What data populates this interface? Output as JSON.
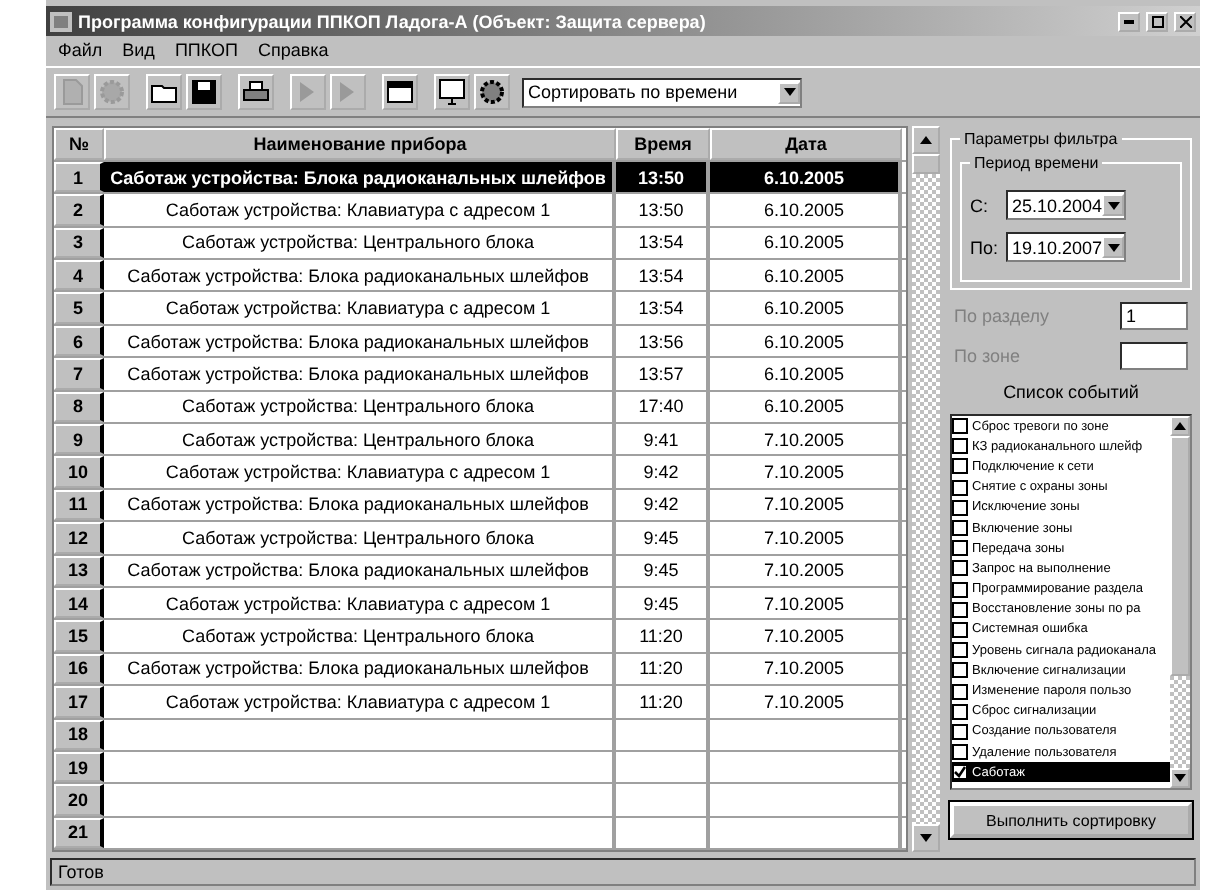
{
  "window": {
    "title": "Программа конфигурации ППКОП Ладога-А (Объект: Защита сервера)"
  },
  "menu": [
    "Файл",
    "Вид",
    "ППКОП",
    "Справка"
  ],
  "toolbar": {
    "buttons": [
      {
        "kind": "doc",
        "disabled": true
      },
      {
        "kind": "gear",
        "disabled": true
      },
      {
        "kind": "folder",
        "disabled": false
      },
      {
        "kind": "save",
        "disabled": false
      },
      {
        "kind": "printer",
        "disabled": false
      },
      {
        "kind": "arrow",
        "disabled": true
      },
      {
        "kind": "arrow",
        "disabled": true
      },
      {
        "kind": "window",
        "disabled": false
      },
      {
        "kind": "monitor",
        "disabled": false
      },
      {
        "kind": "gear",
        "disabled": false
      }
    ],
    "sort_select": {
      "value": "Сортировать по времени"
    }
  },
  "table": {
    "columns": [
      "№",
      "Наименование прибора",
      "Время",
      "Дата"
    ],
    "rows": [
      {
        "num": "1",
        "name": "Саботаж устройства: Блока радиоканальных шлейфов",
        "time": "13:50",
        "date": "6.10.2005",
        "selected": true
      },
      {
        "num": "2",
        "name": "Саботаж устройства: Клавиатура с адресом 1",
        "time": "13:50",
        "date": "6.10.2005",
        "selected": false
      },
      {
        "num": "3",
        "name": "Саботаж устройства: Центрального блока",
        "time": "13:54",
        "date": "6.10.2005",
        "selected": false
      },
      {
        "num": "4",
        "name": "Саботаж устройства: Блока радиоканальных шлейфов",
        "time": "13:54",
        "date": "6.10.2005",
        "selected": false
      },
      {
        "num": "5",
        "name": "Саботаж устройства: Клавиатура с адресом 1",
        "time": "13:54",
        "date": "6.10.2005",
        "selected": false
      },
      {
        "num": "6",
        "name": "Саботаж устройства: Блока радиоканальных шлейфов",
        "time": "13:56",
        "date": "6.10.2005",
        "selected": false
      },
      {
        "num": "7",
        "name": "Саботаж устройства: Блока радиоканальных шлейфов",
        "time": "13:57",
        "date": "6.10.2005",
        "selected": false
      },
      {
        "num": "8",
        "name": "Саботаж устройства: Центрального блока",
        "time": "17:40",
        "date": "6.10.2005",
        "selected": false
      },
      {
        "num": "9",
        "name": "Саботаж устройства: Центрального блока",
        "time": "9:41",
        "date": "7.10.2005",
        "selected": false
      },
      {
        "num": "10",
        "name": "Саботаж устройства: Клавиатура с адресом 1",
        "time": "9:42",
        "date": "7.10.2005",
        "selected": false
      },
      {
        "num": "11",
        "name": "Саботаж устройства: Блока радиоканальных шлейфов",
        "time": "9:42",
        "date": "7.10.2005",
        "selected": false
      },
      {
        "num": "12",
        "name": "Саботаж устройства: Центрального блока",
        "time": "9:45",
        "date": "7.10.2005",
        "selected": false
      },
      {
        "num": "13",
        "name": "Саботаж устройства: Блока радиоканальных шлейфов",
        "time": "9:45",
        "date": "7.10.2005",
        "selected": false
      },
      {
        "num": "14",
        "name": "Саботаж устройства: Клавиатура с адресом 1",
        "time": "9:45",
        "date": "7.10.2005",
        "selected": false
      },
      {
        "num": "15",
        "name": "Саботаж устройства: Центрального блока",
        "time": "11:20",
        "date": "7.10.2005",
        "selected": false
      },
      {
        "num": "16",
        "name": "Саботаж устройства: Блока радиоканальных шлейфов",
        "time": "11:20",
        "date": "7.10.2005",
        "selected": false
      },
      {
        "num": "17",
        "name": "Саботаж устройства: Клавиатура с адресом 1",
        "time": "11:20",
        "date": "7.10.2005",
        "selected": false
      },
      {
        "num": "18",
        "name": "",
        "time": "",
        "date": "",
        "selected": false
      },
      {
        "num": "19",
        "name": "",
        "time": "",
        "date": "",
        "selected": false
      },
      {
        "num": "20",
        "name": "",
        "time": "",
        "date": "",
        "selected": false
      },
      {
        "num": "21",
        "name": "",
        "time": "",
        "date": "",
        "selected": false
      }
    ]
  },
  "filter": {
    "title": "Параметры фильтра",
    "period": {
      "title": "Период времени",
      "from_label": "С:",
      "from": "25.10.2004",
      "to_label": "По:",
      "to": "19.10.2007"
    },
    "section_label": "По разделу",
    "section_value": "1",
    "zone_label": "По зоне",
    "events_title": "Список событий",
    "events": [
      {
        "label": "Сброс тревоги по зоне",
        "checked": false,
        "selected": false
      },
      {
        "label": "КЗ радиоканального шлейф",
        "checked": false,
        "selected": false
      },
      {
        "label": "Подключение к сети",
        "checked": false,
        "selected": false
      },
      {
        "label": "Снятие с охраны зоны",
        "checked": false,
        "selected": false
      },
      {
        "label": "Исключение зоны",
        "checked": false,
        "selected": false
      },
      {
        "label": "Включение зоны",
        "checked": false,
        "selected": false
      },
      {
        "label": "Передача зоны",
        "checked": false,
        "selected": false
      },
      {
        "label": "Запрос на выполнение",
        "checked": false,
        "selected": false
      },
      {
        "label": "Программирование раздела",
        "checked": false,
        "selected": false
      },
      {
        "label": "Восстановление зоны по ра",
        "checked": false,
        "selected": false
      },
      {
        "label": "Системная ошибка",
        "checked": false,
        "selected": false
      },
      {
        "label": "Уровень сигнала радиоканала",
        "checked": false,
        "selected": false
      },
      {
        "label": "Включение сигнализации",
        "checked": false,
        "selected": false
      },
      {
        "label": "Изменение пароля пользо",
        "checked": false,
        "selected": false
      },
      {
        "label": "Сброс сигнализации",
        "checked": false,
        "selected": false
      },
      {
        "label": "Создание пользователя",
        "checked": false,
        "selected": false
      },
      {
        "label": "Удаление пользователя",
        "checked": false,
        "selected": false
      },
      {
        "label": "Саботаж",
        "checked": true,
        "selected": true
      }
    ],
    "apply_button": "Выполнить сортировку"
  },
  "status_bar": "Готов"
}
